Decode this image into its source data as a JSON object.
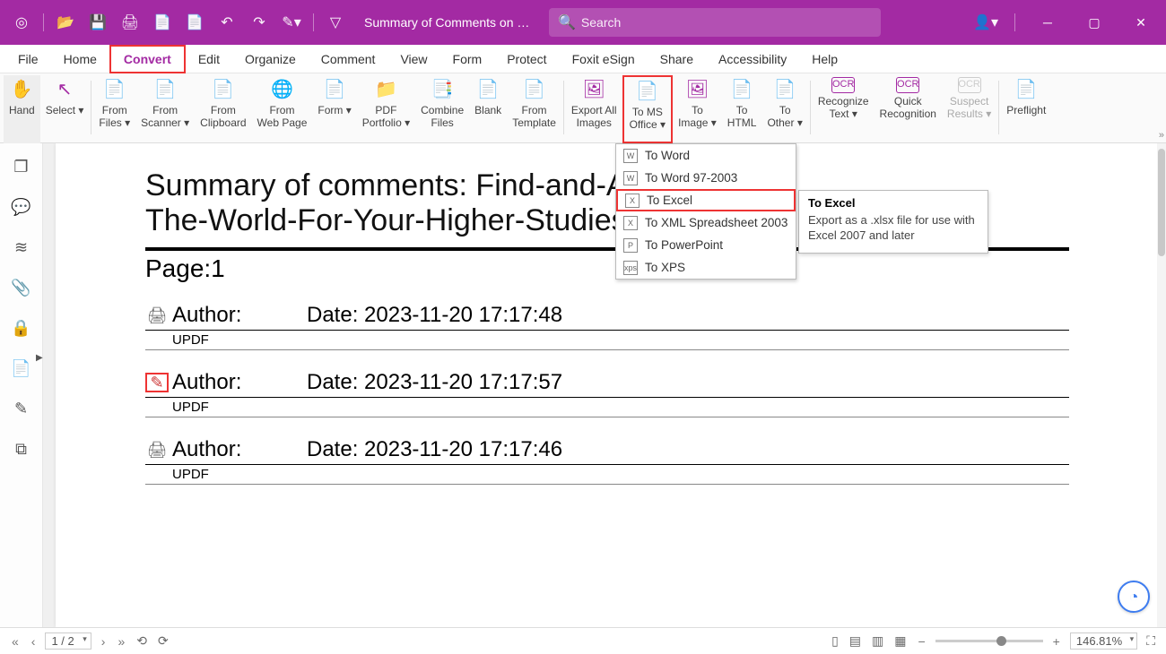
{
  "titlebar": {
    "doc_title": "Summary of Comments on Fin…",
    "search_placeholder": "Search"
  },
  "menubar": {
    "items": [
      "File",
      "Home",
      "Convert",
      "Edit",
      "Organize",
      "Comment",
      "View",
      "Form",
      "Protect",
      "Foxit eSign",
      "Share",
      "Accessibility",
      "Help"
    ],
    "active_index": 2
  },
  "ribbon": {
    "buttons": [
      {
        "label": "Hand",
        "icon": "✋",
        "sel": true
      },
      {
        "label": "Select",
        "icon": "↖",
        "drop": true
      },
      {
        "sep": true
      },
      {
        "label": "From Files",
        "icon": "📄",
        "drop": true,
        "two": "From\nFiles"
      },
      {
        "label": "From Scanner",
        "icon": "📄",
        "drop": true,
        "two": "From\nScanner"
      },
      {
        "label": "From Clipboard",
        "icon": "📄",
        "two": "From\nClipboard"
      },
      {
        "label": "From Web Page",
        "icon": "🌐",
        "two": "From\nWeb Page"
      },
      {
        "label": "Form",
        "icon": "📄",
        "drop": true
      },
      {
        "label": "PDF Portfolio",
        "icon": "📁",
        "drop": true,
        "two": "PDF\nPortfolio"
      },
      {
        "label": "Combine Files",
        "icon": "📑",
        "two": "Combine\nFiles"
      },
      {
        "label": "Blank",
        "icon": "📄"
      },
      {
        "label": "From Template",
        "icon": "📄",
        "two": "From\nTemplate"
      },
      {
        "sep": true
      },
      {
        "label": "Export All Images",
        "icon": "🖼",
        "two": "Export All\nImages"
      },
      {
        "label": "To MS Office",
        "icon": "📄",
        "drop": true,
        "two": "To MS\nOffice",
        "red": true
      },
      {
        "label": "To Image",
        "icon": "🖼",
        "drop": true,
        "two": "To\nImage"
      },
      {
        "label": "To HTML",
        "icon": "📄",
        "two": "To\nHTML"
      },
      {
        "label": "To Other",
        "icon": "📄",
        "drop": true,
        "two": "To\nOther"
      },
      {
        "sep": true
      },
      {
        "label": "Recognize Text",
        "icon": "OCR",
        "drop": true,
        "two": "Recognize\nText"
      },
      {
        "label": "Quick Recognition",
        "icon": "OCR",
        "two": "Quick\nRecognition"
      },
      {
        "label": "Suspect Results",
        "icon": "OCR",
        "drop": true,
        "two": "Suspect\nResults",
        "dim": true
      },
      {
        "sep": true
      },
      {
        "label": "Preflight",
        "icon": "📄"
      }
    ]
  },
  "dropdown": {
    "items": [
      {
        "icon": "W",
        "label": "To Word"
      },
      {
        "icon": "W",
        "label": "To Word 97-2003"
      },
      {
        "icon": "X",
        "label": "To Excel",
        "red": true
      },
      {
        "icon": "X",
        "label": "To XML Spreadsheet 2003"
      },
      {
        "icon": "P",
        "label": "To PowerPoint"
      },
      {
        "icon": "xps",
        "label": "To XPS"
      }
    ]
  },
  "tooltip": {
    "title": "To Excel",
    "body": "Export as a .xlsx file for use with Excel 2007 and later"
  },
  "document": {
    "title_full": "Summary of comments: Find-and-Apply-For-Scholarship-Around-The-World-For-Your-Higher-Studies.pdf",
    "title_visible_prefix": "Summary of comments: Find-and-Ap",
    "title_visible_suffix": "The-World-For-Your-Higher-Studies.pdf",
    "page_label": "Page:1",
    "comments": [
      {
        "icon": "🖨",
        "author_label": "Author:",
        "date_label": "Date: 2023-11-20 17:17:48",
        "sub": "UPDF"
      },
      {
        "icon": "✎",
        "author_label": "Author:",
        "date_label": "Date: 2023-11-20 17:17:57",
        "sub": "UPDF",
        "red_icon": true
      },
      {
        "icon": "🖨",
        "author_label": "Author:",
        "date_label": "Date: 2023-11-20 17:17:46",
        "sub": "UPDF"
      }
    ]
  },
  "statusbar": {
    "page": "1 / 2",
    "zoom": "146.81%"
  }
}
